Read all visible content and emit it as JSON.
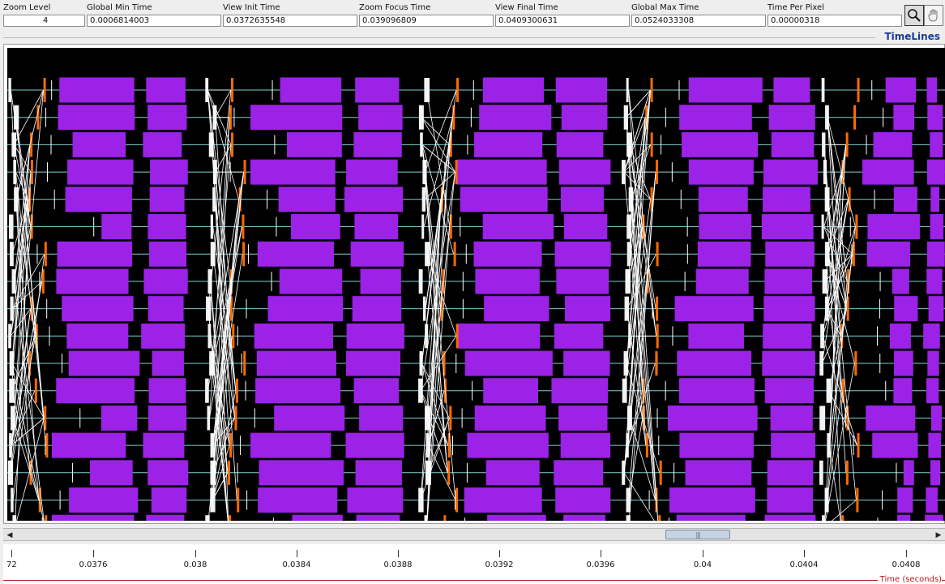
{
  "header": {
    "fields": [
      {
        "label": "Zoom Level",
        "value": "4",
        "align": "center"
      },
      {
        "label": "Global Min Time",
        "value": "0.0006814003"
      },
      {
        "label": "View  Init Time",
        "value": "0.0372635548"
      },
      {
        "label": "Zoom Focus Time",
        "value": "0.039096809"
      },
      {
        "label": "View Final Time",
        "value": "0.0409300631"
      },
      {
        "label": "Global Max Time",
        "value": "0.0524033308"
      },
      {
        "label": "Time Per Pixel",
        "value": "0.00000318"
      }
    ],
    "tools": [
      {
        "name": "zoom-tool",
        "icon": "magnifier-icon",
        "active": true
      },
      {
        "name": "hand-tool",
        "icon": "hand-icon",
        "active": false
      }
    ]
  },
  "view": {
    "title": "TimeLines",
    "timeline_count": 17,
    "colors": {
      "background": "#000000",
      "timeline": "#7fd0d4",
      "state": "#9b22e6",
      "event": "#ff6a00",
      "arrow": "#ffffff"
    }
  },
  "axis": {
    "title": "Time (seconds)",
    "ticks": [
      "72",
      "0.0376",
      "0.038",
      "0.0384",
      "0.0388",
      "0.0392",
      "0.0396",
      "0.04",
      "0.0404",
      "0.0408"
    ]
  }
}
